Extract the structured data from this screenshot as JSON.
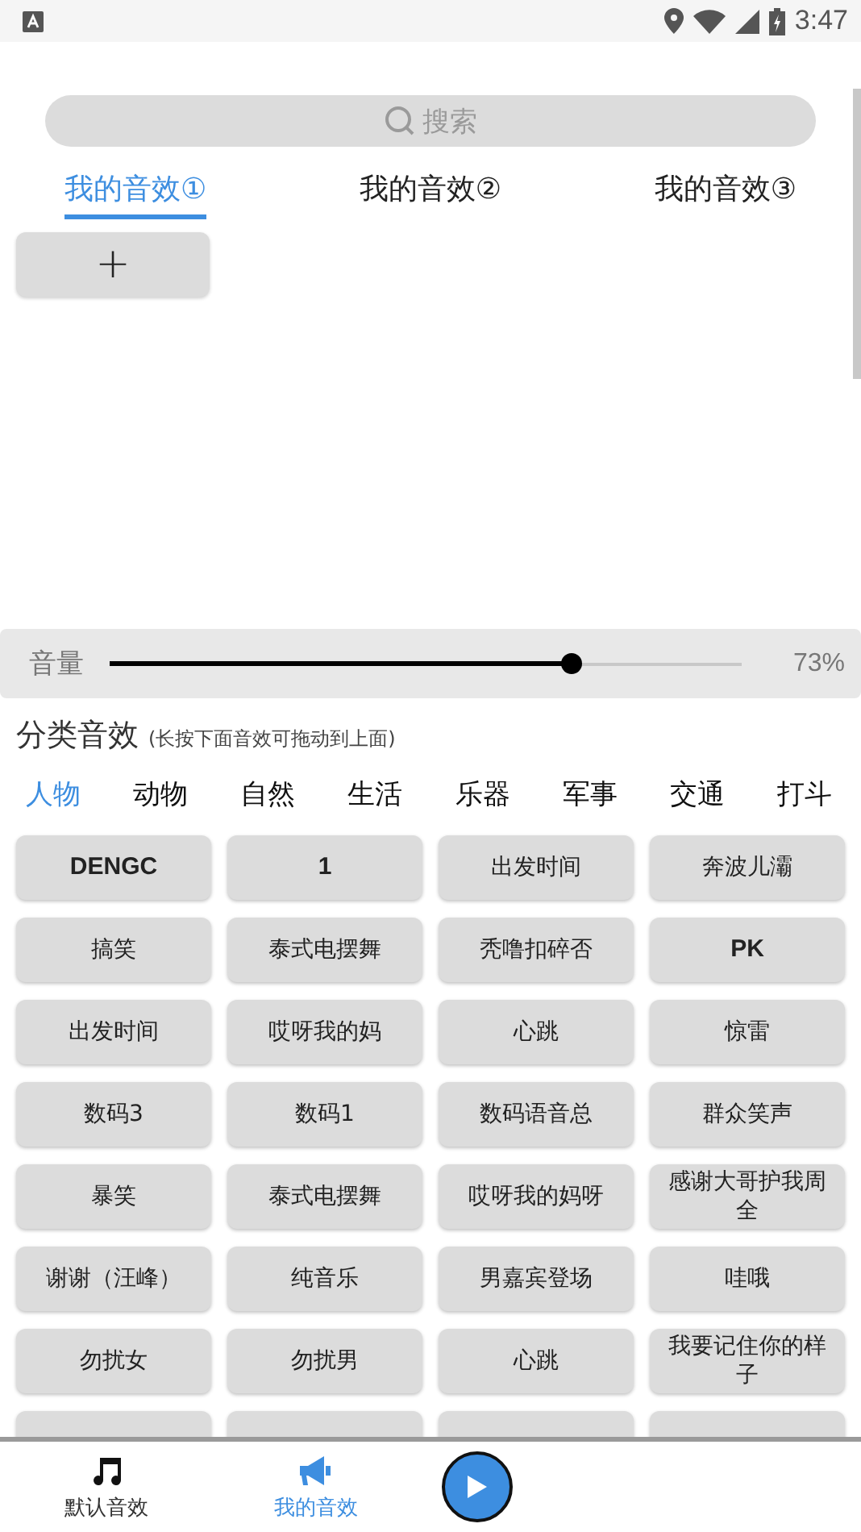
{
  "status_bar": {
    "time": "3:47"
  },
  "search": {
    "placeholder": "搜索"
  },
  "my_tabs": [
    {
      "label": "我的音效①",
      "selected": true
    },
    {
      "label": "我的音效②",
      "selected": false
    },
    {
      "label": "我的音效③",
      "selected": false
    }
  ],
  "add_button": {
    "label": "+"
  },
  "volume": {
    "label": "音量",
    "level": 0.73,
    "reading": "73%"
  },
  "section": {
    "title": "分类音效",
    "hint": "(长按下面音效可拖动到上面)"
  },
  "categories": [
    {
      "label": "人物",
      "selected": true
    },
    {
      "label": "动物",
      "selected": false
    },
    {
      "label": "自然",
      "selected": false
    },
    {
      "label": "生活",
      "selected": false
    },
    {
      "label": "乐器",
      "selected": false
    },
    {
      "label": "军事",
      "selected": false
    },
    {
      "label": "交通",
      "selected": false
    },
    {
      "label": "打斗",
      "selected": false
    }
  ],
  "sound_rows": [
    [
      "DENGC",
      "1",
      "出发时间",
      "奔波儿灞"
    ],
    [
      "搞笑",
      "泰式电摆舞",
      "秃噜扣碎否",
      "PK"
    ],
    [
      "出发时间",
      "哎呀我的妈",
      "心跳",
      "惊雷"
    ],
    [
      "数码3",
      "数码1",
      "数码语音总",
      "群众笑声"
    ],
    [
      "暴笑",
      "泰式电摆舞",
      "哎呀我的妈呀",
      "感谢大哥护我周全"
    ],
    [
      "谢谢（汪峰）",
      "纯音乐",
      "男嘉宾登场",
      "哇哦"
    ],
    [
      "勿扰女",
      "勿扰男",
      "心跳",
      "我要记住你的样子"
    ]
  ],
  "bottom_nav": [
    {
      "kind": "music",
      "label": "默认音效",
      "selected": false
    },
    {
      "kind": "effects",
      "label": "我的音效",
      "selected": true
    },
    {
      "kind": "play"
    }
  ]
}
